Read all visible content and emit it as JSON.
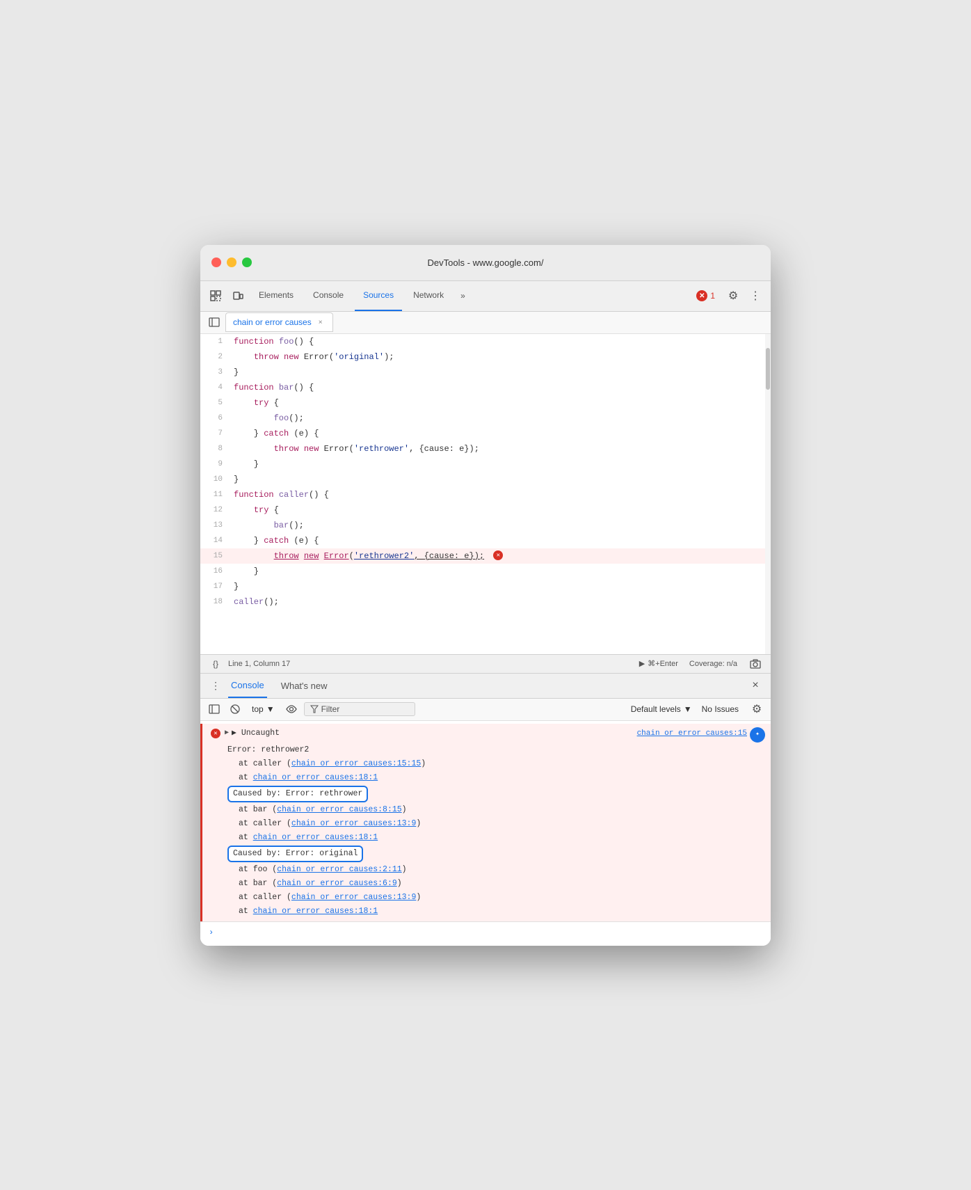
{
  "titlebar": {
    "title": "DevTools - www.google.com/"
  },
  "tabs": {
    "items": [
      "Elements",
      "Console",
      "Sources",
      "Network"
    ],
    "active": "Sources",
    "more": "»",
    "error_count": "1"
  },
  "file_tab": {
    "name": "chain or error causes",
    "close": "×"
  },
  "code": {
    "lines": [
      {
        "num": 1,
        "content": "function foo() {"
      },
      {
        "num": 2,
        "content": "    throw new Error('original');"
      },
      {
        "num": 3,
        "content": "}"
      },
      {
        "num": 4,
        "content": "function bar() {"
      },
      {
        "num": 5,
        "content": "    try {"
      },
      {
        "num": 6,
        "content": "        foo();"
      },
      {
        "num": 7,
        "content": "    } catch (e) {"
      },
      {
        "num": 8,
        "content": "        throw new Error('rethrower', {cause: e});"
      },
      {
        "num": 9,
        "content": "    }"
      },
      {
        "num": 10,
        "content": "}"
      },
      {
        "num": 11,
        "content": "function caller() {"
      },
      {
        "num": 12,
        "content": "    try {"
      },
      {
        "num": 13,
        "content": "        bar();"
      },
      {
        "num": 14,
        "content": "    } catch (e) {"
      },
      {
        "num": 15,
        "content": "        throw new Error('rethrower2', {cause: e});",
        "error": true
      },
      {
        "num": 16,
        "content": "    }"
      },
      {
        "num": 17,
        "content": "}"
      },
      {
        "num": 18,
        "content": "caller();"
      }
    ]
  },
  "status_bar": {
    "position": "Line 1, Column 17",
    "run_label": "⌘+Enter",
    "coverage": "Coverage: n/a",
    "pretty_print": "{}"
  },
  "console": {
    "header": {
      "tabs": [
        "Console",
        "What's new"
      ],
      "active": "Console"
    },
    "toolbar": {
      "top_label": "top",
      "filter_placeholder": "Filter",
      "default_levels": "Default levels",
      "no_issues": "No Issues"
    },
    "error": {
      "main_label": "▶ Uncaught",
      "source_link": "chain or error causes:15",
      "lines": [
        {
          "type": "text",
          "content": "Error: rethrower2"
        },
        {
          "type": "stack",
          "text": "at caller (",
          "link": "chain or error causes:15:15",
          "suffix": ")"
        },
        {
          "type": "stack",
          "text": "at ",
          "link": "chain or error causes:18:1"
        }
      ],
      "caused1": {
        "label": "Caused by: Error: rethrower",
        "stack": [
          {
            "text": "at bar (",
            "link": "chain or error causes:8:15",
            "suffix": ")"
          },
          {
            "text": "at caller (",
            "link": "chain or error causes:13:9",
            "suffix": ")"
          },
          {
            "text": "at ",
            "link": "chain or error causes:18:1"
          }
        ]
      },
      "caused2": {
        "label": "Caused by: Error: original",
        "stack": [
          {
            "text": "at foo (",
            "link": "chain or error causes:2:11",
            "suffix": ")"
          },
          {
            "text": "at bar (",
            "link": "chain or error causes:6:9",
            "suffix": ")"
          },
          {
            "text": "at caller (",
            "link": "chain or error causes:13:9",
            "suffix": ")"
          },
          {
            "text": "at ",
            "link": "chain or error causes:18:1"
          }
        ]
      }
    }
  }
}
